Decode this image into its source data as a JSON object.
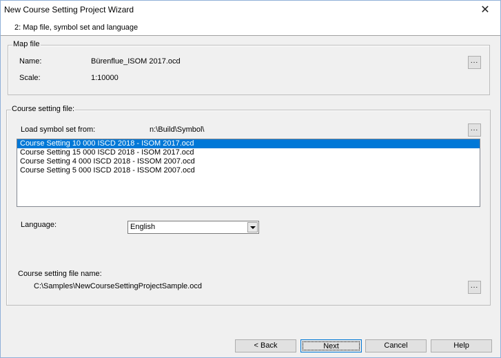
{
  "window": {
    "title": "New Course Setting Project Wizard",
    "close_glyph": "✕"
  },
  "step": {
    "title": "2: Map file, symbol set and language"
  },
  "map_file": {
    "legend": "Map file",
    "name_label": "Name:",
    "name_value": "Bürenflue_ISOM 2017.ocd",
    "scale_label": "Scale:",
    "scale_value": "1:10000",
    "browse_label": "..."
  },
  "course_setting_file": {
    "legend": "Course setting file:",
    "load_label": "Load symbol set from:",
    "load_path": "n:\\Build\\Symbol\\",
    "browse_label": "...",
    "symbol_sets": [
      {
        "label": "Course Setting 10 000 ISCD 2018 - ISOM 2017.ocd",
        "selected": true
      },
      {
        "label": "Course Setting 15 000 ISCD 2018 - ISOM 2017.ocd",
        "selected": false
      },
      {
        "label": "Course Setting 4 000 ISCD 2018 - ISSOM 2007.ocd",
        "selected": false
      },
      {
        "label": "Course Setting 5 000 ISCD 2018 - ISSOM 2007.ocd",
        "selected": false
      }
    ],
    "language_label": "Language:",
    "language_value": "English",
    "file_name_label": "Course setting file name:",
    "file_name_value": "C:\\Samples\\NewCourseSettingProjectSample.ocd",
    "file_browse_label": "..."
  },
  "buttons": {
    "back": "< Back",
    "next": "Next",
    "cancel": "Cancel",
    "help": "Help"
  },
  "colors": {
    "selection": "#0078d7",
    "background": "#f0f0f0"
  }
}
